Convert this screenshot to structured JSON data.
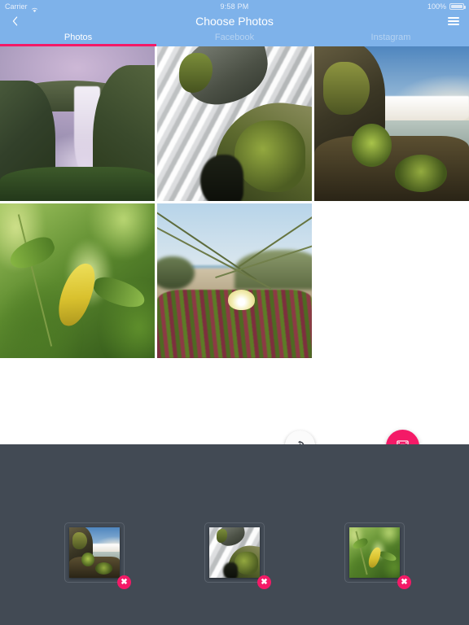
{
  "status_bar": {
    "carrier": "Carrier",
    "wifi_icon": "wifi-icon",
    "time": "9:58 PM",
    "battery_percent": "100%",
    "battery_icon": "battery-full-icon"
  },
  "nav_bar": {
    "title": "Choose Photos",
    "back_icon": "chevron-left-icon",
    "menu_icon": "hamburger-menu-icon",
    "background_color": "#7EB2EA",
    "title_color": "#FFFFFF"
  },
  "tabs": {
    "active_index": 0,
    "indicator_color": "#F41A67",
    "items": [
      {
        "label": "Photos"
      },
      {
        "label": "Facebook"
      },
      {
        "label": "Instagram"
      }
    ]
  },
  "grid": {
    "columns": 3,
    "rows": 2,
    "photos": [
      {
        "id": "p1",
        "alt": "Tall waterfall over green cliffs under purple mist",
        "art": "p-waterfall1"
      },
      {
        "id": "p2",
        "alt": "Long exposure cascade over mossy rocks",
        "art": "p-waterfall2"
      },
      {
        "id": "p3",
        "alt": "Wide waterfall into lake with mossy foreground rocks",
        "art": "p-waterfall3"
      },
      {
        "id": "p4",
        "alt": "Close up of green leaves with one yellow leaf",
        "art": "p-leaves"
      },
      {
        "id": "p5",
        "alt": "Beach dune with ice plant and white flower",
        "art": "p-beach"
      }
    ]
  },
  "actions": {
    "history_button": {
      "icon": "history-rotate-ccw-icon",
      "color": "#FFFFFF",
      "icon_color": "#3B4049"
    },
    "add_button": {
      "icon": "film-strip-plus-icon",
      "color": "#F41A67",
      "icon_color": "#FFFFFF"
    }
  },
  "tray": {
    "background_color": "#424A54",
    "selected": [
      {
        "id": "s1",
        "alt": "Wide waterfall into lake",
        "art": "p-waterfall3",
        "remove_label": "✖"
      },
      {
        "id": "s2",
        "alt": "Long exposure cascade",
        "art": "p-waterfall2",
        "remove_label": "✖"
      },
      {
        "id": "s3",
        "alt": "Green leaves with yellow leaf",
        "art": "p-leaves",
        "remove_label": "✖"
      }
    ]
  }
}
